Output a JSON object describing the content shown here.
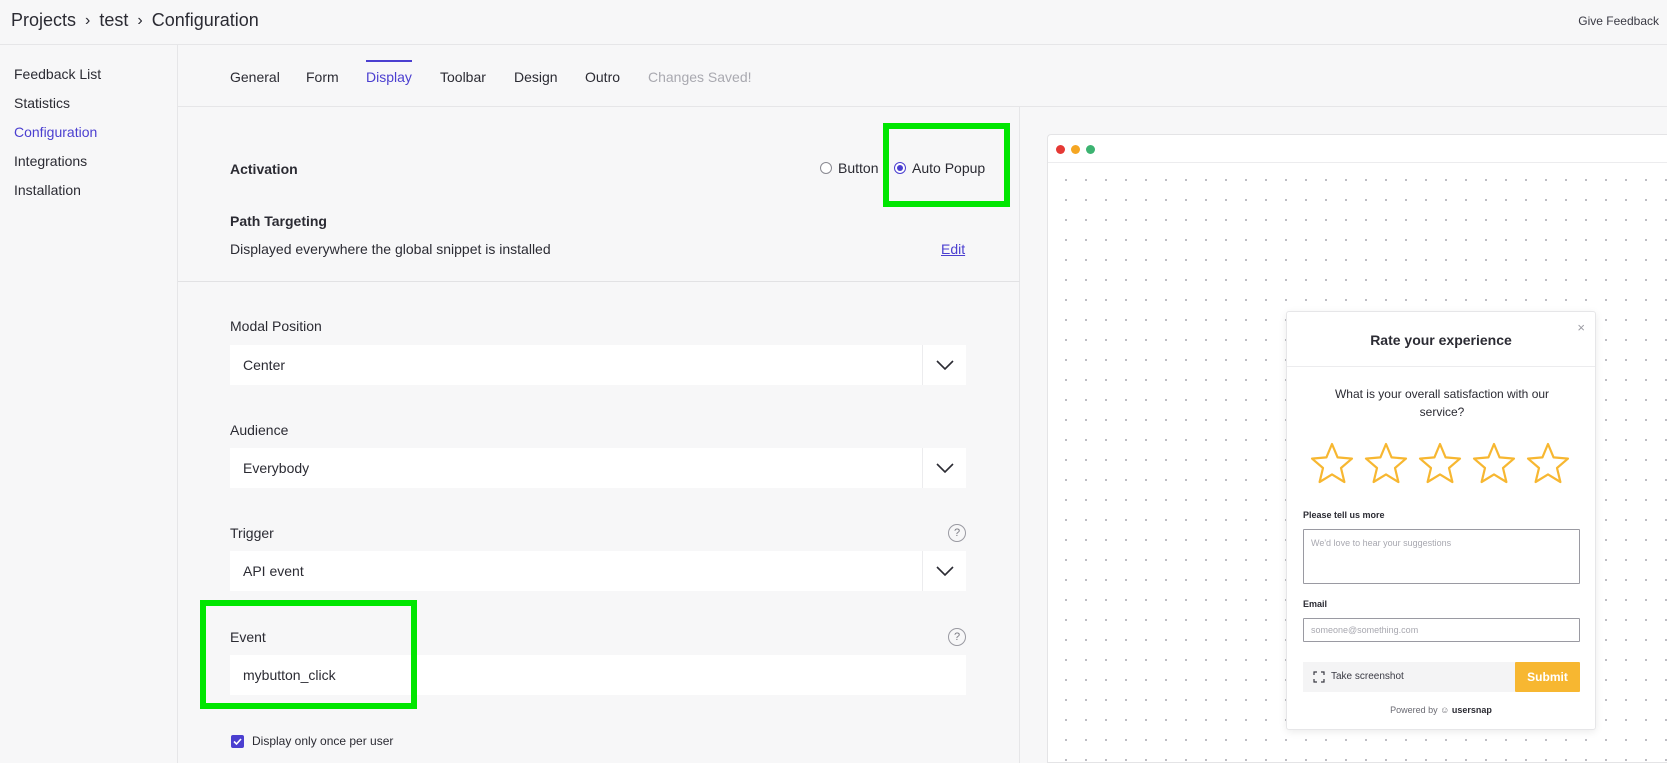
{
  "breadcrumb": {
    "items": [
      "Projects",
      "test",
      "Configuration"
    ],
    "separator": "›"
  },
  "header": {
    "give_feedback": "Give Feedback"
  },
  "sidebar": {
    "items": [
      {
        "label": "Feedback List"
      },
      {
        "label": "Statistics"
      },
      {
        "label": "Configuration",
        "active": true
      },
      {
        "label": "Integrations"
      },
      {
        "label": "Installation"
      }
    ]
  },
  "tabs": {
    "items": [
      "General",
      "Form",
      "Display",
      "Toolbar",
      "Design",
      "Outro"
    ],
    "active": "Display",
    "status": "Changes Saved!"
  },
  "activation": {
    "label": "Activation",
    "options": [
      "Button",
      "Auto Popup"
    ],
    "selected": "Auto Popup"
  },
  "path_targeting": {
    "label": "Path Targeting",
    "description": "Displayed everywhere the global snippet is installed",
    "edit_label": "Edit"
  },
  "modal_position": {
    "label": "Modal Position",
    "value": "Center"
  },
  "audience": {
    "label": "Audience",
    "value": "Everybody"
  },
  "trigger": {
    "label": "Trigger",
    "value": "API event",
    "help": "?"
  },
  "event": {
    "label": "Event",
    "value": "mybutton_click",
    "help": "?"
  },
  "display_once": {
    "label": "Display only once per user",
    "checked": true
  },
  "preview": {
    "dots": [
      "#e53935",
      "#f5a623",
      "#3cb371"
    ],
    "widget": {
      "title": "Rate your experience",
      "close": "×",
      "question": "What is your overall satisfaction with our service?",
      "star_count": 5,
      "star_color": "#f7b731",
      "more_label": "Please tell us more",
      "more_placeholder": "We'd love to hear your suggestions",
      "email_label": "Email",
      "email_placeholder": "someone@something.com",
      "screenshot_label": "Take screenshot",
      "submit_label": "Submit",
      "powered_prefix": "Powered by",
      "powered_brand": "usersnap"
    }
  },
  "colors": {
    "accent": "#4b3fd0",
    "highlight": "#00e600",
    "submit": "#f7b731"
  }
}
